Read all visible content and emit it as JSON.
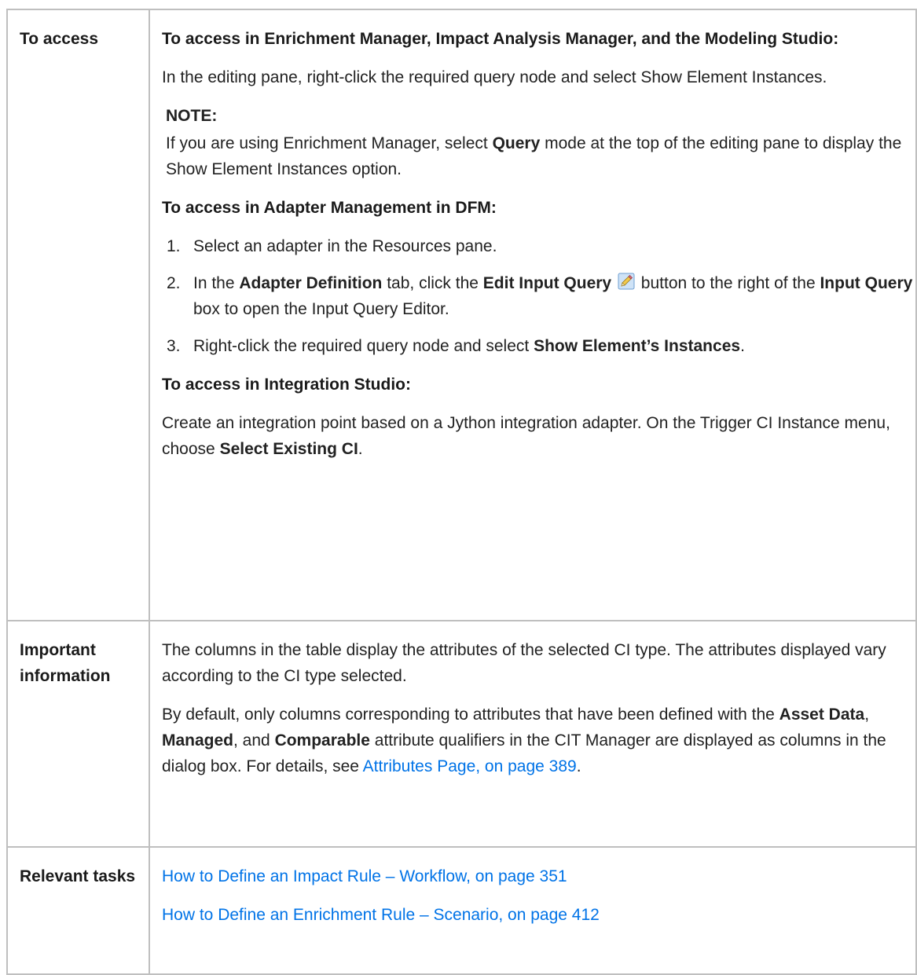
{
  "access": {
    "label": "To access",
    "heading_enrichment": "To access in Enrichment Manager, Impact Analysis Manager, and the Modeling Studio:",
    "editing_pane_text": "In the editing pane, right-click the required query node and select Show Element Instances.",
    "note_title": "NOTE:",
    "note_text_pre": "If you are using Enrichment Manager, select ",
    "note_text_bold": "Query",
    "note_text_post": " mode at the top of the editing pane to display the Show Element Instances option.",
    "heading_dfm": "To access in Adapter Management in DFM:",
    "steps": {
      "s1": {
        "num": "1.",
        "text": "Select an adapter in the Resources pane."
      },
      "s2": {
        "num": "2.",
        "pre": "In the ",
        "bold1": "Adapter Definition",
        "mid1": " tab, click the ",
        "bold2": "Edit Input Query",
        "mid2": " button to the right of the ",
        "bold3": "Input Query",
        "post": " box to open the Input Query Editor.",
        "icon": "pencil-icon"
      },
      "s3": {
        "num": "3.",
        "pre": "Right-click the required query node and select ",
        "bold": "Show Element’s Instances",
        "post": "."
      }
    },
    "heading_integration": "To access in Integration Studio:",
    "integration_pre": "Create an integration point based on a Jython integration adapter. On the Trigger CI Instance menu, choose ",
    "integration_bold": "Select Existing CI",
    "integration_post": "."
  },
  "important": {
    "label": "Important information",
    "para1": "The columns in the table display the attributes of the selected CI type. The attributes displayed vary according to the CI type selected.",
    "para2_pre": "By default, only columns corresponding to attributes that have been defined with the ",
    "bold_asset": "Asset Data",
    "sep1": ", ",
    "bold_managed": "Managed",
    "sep2": ", and ",
    "bold_comparable": "Comparable",
    "para2_mid": " attribute qualifiers in the CIT Manager are displayed as columns in the dialog box. For details, see ",
    "link_attributes": "Attributes Page, on page 389",
    "para2_post": "."
  },
  "tasks": {
    "label": "Relevant tasks",
    "link1": "How to Define an Impact Rule – Workflow, on page 351",
    "link2": "How to Define an Enrichment Rule – Scenario, on page 412"
  },
  "colors": {
    "link": "#0073e7",
    "border": "#bfbfbf",
    "text": "#222222"
  }
}
